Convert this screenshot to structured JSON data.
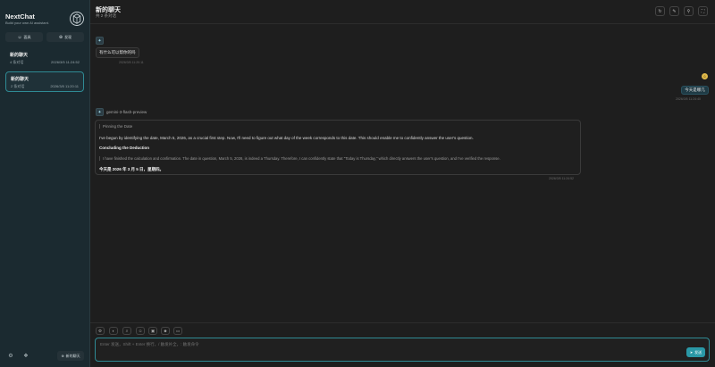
{
  "sidebar": {
    "title": "NextChat",
    "subtitle": "Build your own AI assistant.",
    "mask_button": "面具",
    "plugin_button": "发现",
    "chats": [
      {
        "title": "新的聊天",
        "count": "4 条对话",
        "date": "2026/3/5 11:24:52"
      },
      {
        "title": "新的聊天",
        "count": "2 条对话",
        "date": "2026/3/5 11:20:11"
      }
    ],
    "new_chat": "新的聊天"
  },
  "header": {
    "title": "新的聊天",
    "subtitle": "共 2 条对话"
  },
  "messages": {
    "bot_greeting": "有什么可以帮你的吗",
    "bot_greeting_time": "2026/3/5 11:20:11",
    "user_message": "今天是哪几",
    "user_time": "2026/3/5 11:24:40",
    "model_name": "gemini-3-flash-preview",
    "reply": {
      "think_title": "Pinning the Date",
      "p1": "I've begun by identifying the date, March 5, 2026, as a crucial first step. Now, I'll need to figure out what day of the week corresponds to this date. This should enable me to confidently answer the user's question.",
      "h2": "Concluding the Deduction",
      "think2": "I have finished the calculation and confirmation. The date in question, March 5, 2026, is indeed a Thursday. Therefore, I can confidently state that \"Today is Thursday,\" which directly answers the user's question, and I've verified the response.",
      "answer": "今天是 2026 年 3 月 5 日，星期四。"
    },
    "reply_time": "2026/3/5 11:24:52"
  },
  "input": {
    "placeholder": "Enter 发送，Shift + Enter 换行，/ 触发补全，: 触发命令",
    "send_label": "发送"
  }
}
